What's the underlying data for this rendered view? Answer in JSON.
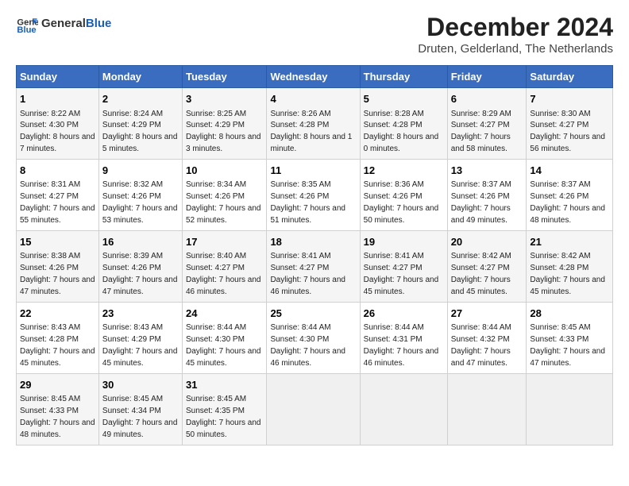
{
  "header": {
    "logo_line1": "General",
    "logo_line2": "Blue",
    "title": "December 2024",
    "subtitle": "Druten, Gelderland, The Netherlands"
  },
  "days_of_week": [
    "Sunday",
    "Monday",
    "Tuesday",
    "Wednesday",
    "Thursday",
    "Friday",
    "Saturday"
  ],
  "weeks": [
    [
      {
        "day": 1,
        "sunrise": "8:22 AM",
        "sunset": "4:30 PM",
        "daylight": "8 hours and 7 minutes."
      },
      {
        "day": 2,
        "sunrise": "8:24 AM",
        "sunset": "4:29 PM",
        "daylight": "8 hours and 5 minutes."
      },
      {
        "day": 3,
        "sunrise": "8:25 AM",
        "sunset": "4:29 PM",
        "daylight": "8 hours and 3 minutes."
      },
      {
        "day": 4,
        "sunrise": "8:26 AM",
        "sunset": "4:28 PM",
        "daylight": "8 hours and 1 minute."
      },
      {
        "day": 5,
        "sunrise": "8:28 AM",
        "sunset": "4:28 PM",
        "daylight": "8 hours and 0 minutes."
      },
      {
        "day": 6,
        "sunrise": "8:29 AM",
        "sunset": "4:27 PM",
        "daylight": "7 hours and 58 minutes."
      },
      {
        "day": 7,
        "sunrise": "8:30 AM",
        "sunset": "4:27 PM",
        "daylight": "7 hours and 56 minutes."
      }
    ],
    [
      {
        "day": 8,
        "sunrise": "8:31 AM",
        "sunset": "4:27 PM",
        "daylight": "7 hours and 55 minutes."
      },
      {
        "day": 9,
        "sunrise": "8:32 AM",
        "sunset": "4:26 PM",
        "daylight": "7 hours and 53 minutes."
      },
      {
        "day": 10,
        "sunrise": "8:34 AM",
        "sunset": "4:26 PM",
        "daylight": "7 hours and 52 minutes."
      },
      {
        "day": 11,
        "sunrise": "8:35 AM",
        "sunset": "4:26 PM",
        "daylight": "7 hours and 51 minutes."
      },
      {
        "day": 12,
        "sunrise": "8:36 AM",
        "sunset": "4:26 PM",
        "daylight": "7 hours and 50 minutes."
      },
      {
        "day": 13,
        "sunrise": "8:37 AM",
        "sunset": "4:26 PM",
        "daylight": "7 hours and 49 minutes."
      },
      {
        "day": 14,
        "sunrise": "8:37 AM",
        "sunset": "4:26 PM",
        "daylight": "7 hours and 48 minutes."
      }
    ],
    [
      {
        "day": 15,
        "sunrise": "8:38 AM",
        "sunset": "4:26 PM",
        "daylight": "7 hours and 47 minutes."
      },
      {
        "day": 16,
        "sunrise": "8:39 AM",
        "sunset": "4:26 PM",
        "daylight": "7 hours and 47 minutes."
      },
      {
        "day": 17,
        "sunrise": "8:40 AM",
        "sunset": "4:27 PM",
        "daylight": "7 hours and 46 minutes."
      },
      {
        "day": 18,
        "sunrise": "8:41 AM",
        "sunset": "4:27 PM",
        "daylight": "7 hours and 46 minutes."
      },
      {
        "day": 19,
        "sunrise": "8:41 AM",
        "sunset": "4:27 PM",
        "daylight": "7 hours and 45 minutes."
      },
      {
        "day": 20,
        "sunrise": "8:42 AM",
        "sunset": "4:27 PM",
        "daylight": "7 hours and 45 minutes."
      },
      {
        "day": 21,
        "sunrise": "8:42 AM",
        "sunset": "4:28 PM",
        "daylight": "7 hours and 45 minutes."
      }
    ],
    [
      {
        "day": 22,
        "sunrise": "8:43 AM",
        "sunset": "4:28 PM",
        "daylight": "7 hours and 45 minutes."
      },
      {
        "day": 23,
        "sunrise": "8:43 AM",
        "sunset": "4:29 PM",
        "daylight": "7 hours and 45 minutes."
      },
      {
        "day": 24,
        "sunrise": "8:44 AM",
        "sunset": "4:30 PM",
        "daylight": "7 hours and 45 minutes."
      },
      {
        "day": 25,
        "sunrise": "8:44 AM",
        "sunset": "4:30 PM",
        "daylight": "7 hours and 46 minutes."
      },
      {
        "day": 26,
        "sunrise": "8:44 AM",
        "sunset": "4:31 PM",
        "daylight": "7 hours and 46 minutes."
      },
      {
        "day": 27,
        "sunrise": "8:44 AM",
        "sunset": "4:32 PM",
        "daylight": "7 hours and 47 minutes."
      },
      {
        "day": 28,
        "sunrise": "8:45 AM",
        "sunset": "4:33 PM",
        "daylight": "7 hours and 47 minutes."
      }
    ],
    [
      {
        "day": 29,
        "sunrise": "8:45 AM",
        "sunset": "4:33 PM",
        "daylight": "7 hours and 48 minutes."
      },
      {
        "day": 30,
        "sunrise": "8:45 AM",
        "sunset": "4:34 PM",
        "daylight": "7 hours and 49 minutes."
      },
      {
        "day": 31,
        "sunrise": "8:45 AM",
        "sunset": "4:35 PM",
        "daylight": "7 hours and 50 minutes."
      },
      null,
      null,
      null,
      null
    ]
  ]
}
